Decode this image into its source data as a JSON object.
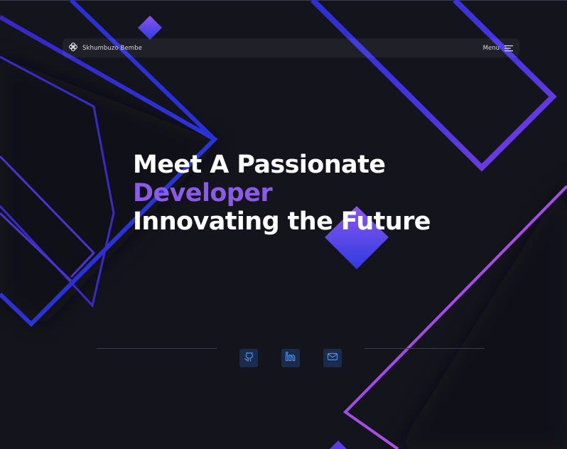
{
  "brand": {
    "name": "Skhumbuzo Bembe",
    "logo_icon": "flower-logo-icon"
  },
  "nav": {
    "menu_label": "Menu",
    "menu_icon": "hamburger-menu-icon"
  },
  "hero": {
    "line1": "Meet A Passionate",
    "line2": "Developer",
    "line3": "Innovating the Future"
  },
  "social": [
    {
      "name": "github",
      "icon": "github-icon"
    },
    {
      "name": "linkedin",
      "icon": "linkedin-icon"
    },
    {
      "name": "email",
      "icon": "mail-icon"
    }
  ],
  "colors": {
    "background": "#14141c",
    "accent_purple": "#8a5ce6",
    "accent_blue": "#1f2ed6",
    "social_bg": "#1b2b4a",
    "social_icon": "#4d8ef0"
  }
}
